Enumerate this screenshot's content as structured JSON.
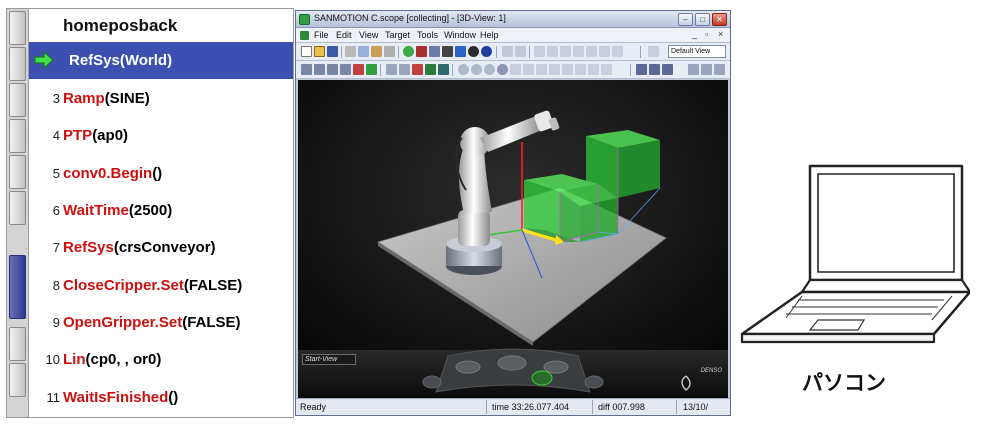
{
  "editor": {
    "header": "homeposback",
    "lines": [
      {
        "num": "",
        "keyword": "RefSys",
        "rest": "(World)",
        "current": true
      },
      {
        "num": "3",
        "keyword": "Ramp",
        "rest": "(SINE)",
        "current": false
      },
      {
        "num": "4",
        "keyword": "PTP",
        "rest": "(ap0)",
        "current": false
      },
      {
        "num": "5",
        "keyword": "conv0.Begin",
        "rest": "()",
        "current": false
      },
      {
        "num": "6",
        "keyword": "WaitTime",
        "rest": "(2500)",
        "current": false
      },
      {
        "num": "7",
        "keyword": "RefSys",
        "rest": "(crsConveyor)",
        "current": false
      },
      {
        "num": "8",
        "keyword": "CloseCripper.Set",
        "rest": "(FALSE)",
        "current": false
      },
      {
        "num": "9",
        "keyword": "OpenGripper.Set",
        "rest": "(FALSE)",
        "current": false
      },
      {
        "num": "10",
        "keyword": "Lin",
        "rest": "(cp0, , or0)",
        "current": false
      },
      {
        "num": "11",
        "keyword": "WaitIsFinished",
        "rest": "()",
        "current": false
      }
    ]
  },
  "app": {
    "title": "SANMOTION C.scope [collecting] - [3D-View: 1]",
    "menu": [
      "File",
      "Edit",
      "View",
      "Target",
      "Tools",
      "Window",
      "Help"
    ],
    "view_select": "Default View",
    "start_view": "Start-View",
    "logo": "DENSO",
    "status": {
      "ready": "Ready",
      "time": "time 33:26.077.404",
      "diff": "diff 007.998",
      "count": "13/10/"
    }
  },
  "laptop": {
    "caption": "パソコン"
  },
  "colors": {
    "keyword": "#cc1010",
    "current_line": "#3d4fb0",
    "box_green": "#2fd13a"
  }
}
